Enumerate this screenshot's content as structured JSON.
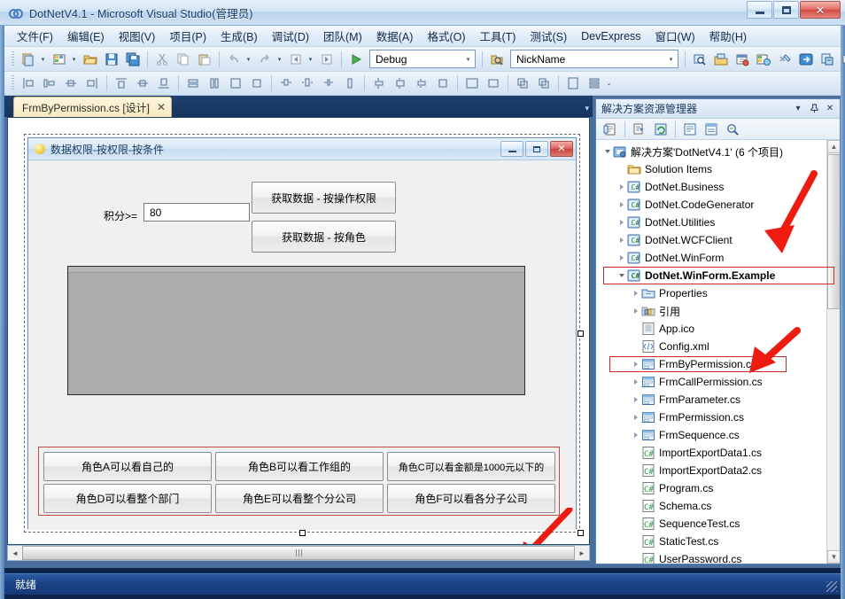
{
  "window": {
    "title": "DotNetV4.1 - Microsoft Visual Studio(管理员)",
    "app_icon": "visual-studio-icon",
    "minimize_label": "–",
    "maximize_label": "□",
    "close_label": "✕"
  },
  "menubar": {
    "items": [
      {
        "label": "文件(F)"
      },
      {
        "label": "编辑(E)"
      },
      {
        "label": "视图(V)"
      },
      {
        "label": "项目(P)"
      },
      {
        "label": "生成(B)"
      },
      {
        "label": "调试(D)"
      },
      {
        "label": "团队(M)"
      },
      {
        "label": "数据(A)"
      },
      {
        "label": "格式(O)"
      },
      {
        "label": "工具(T)"
      },
      {
        "label": "测试(S)"
      },
      {
        "label": "DevExpress"
      },
      {
        "label": "窗口(W)"
      },
      {
        "label": "帮助(H)"
      }
    ]
  },
  "toolbar": {
    "config_combo": {
      "value": "Debug",
      "caret": "▾"
    },
    "nickname_combo": {
      "value": "NickName",
      "caret": "▾"
    },
    "start_button_label": "▶",
    "icons": [
      "new-project-icon",
      "new-item-icon",
      "open-file-icon",
      "save-icon",
      "save-all-icon",
      "cut-icon",
      "copy-icon",
      "paste-icon",
      "undo-icon",
      "redo-icon",
      "navigate-backward-icon",
      "navigate-forward-icon"
    ],
    "right_icons": [
      "find-icon",
      "solution-explorer-icon",
      "properties-window-icon",
      "object-browser-icon",
      "toolbox-icon",
      "go-icon",
      "class-view-icon",
      "other-windows-icon"
    ],
    "layout_icons": [
      "align-lefts-icon",
      "align-centers-icon",
      "align-middles-icon",
      "align-rights-icon",
      "align-tops-icon",
      "align-middles2-icon",
      "align-bottoms-icon",
      "make-same-width-icon",
      "make-same-height-icon",
      "make-same-size-icon",
      "size-to-grid-icon",
      "horiz-spacing-equal-icon",
      "horiz-spacing-increase-icon",
      "horiz-spacing-decrease-icon",
      "horiz-spacing-remove-icon",
      "vert-spacing-equal-icon",
      "vert-spacing-increase-icon",
      "vert-spacing-decrease-icon",
      "vert-spacing-remove-icon",
      "center-horizontally-icon",
      "center-vertically-icon",
      "bring-to-front-icon",
      "send-to-back-icon",
      "tab-order-icon",
      "table-layout-icon"
    ]
  },
  "document_tabs": {
    "tabs": [
      {
        "label": "FrmByPermission.cs [设计]",
        "close_label": "✕",
        "active": true
      }
    ],
    "nav_label": "▾"
  },
  "designer": {
    "form": {
      "title": "数据权限-按权限-按条件",
      "icon": "form-icon",
      "minimize_label": "–",
      "maximize_label": "□",
      "close_label": "✕",
      "score_label": "积分>=",
      "score_value": "80",
      "buttons_top": [
        {
          "label": "获取数据 - 按操作权限"
        },
        {
          "label": "获取数据 - 按角色"
        }
      ],
      "grid_name": "data-grid-placeholder",
      "role_buttons": [
        {
          "label": "角色A可以看自己的"
        },
        {
          "label": "角色B可以看工作组的"
        },
        {
          "label": "角色C可以看金额是1000元以下的"
        },
        {
          "label": "角色D可以看整个部门"
        },
        {
          "label": "角色E可以看整个分公司"
        },
        {
          "label": "角色F可以看各分子公司"
        }
      ]
    },
    "hscroll": {
      "left_arrow": "◄",
      "right_arrow": "►",
      "grip": "⦙⦙⦙"
    }
  },
  "solution_explorer": {
    "title": "解决方案资源管理器",
    "header_buttons": [
      {
        "name": "dropdown",
        "label": "▾"
      },
      {
        "name": "auto-hide",
        "label": "⚲"
      },
      {
        "name": "close",
        "label": "✕"
      }
    ],
    "toolbar_icons": [
      "properties-icon",
      "show-all-files-icon",
      "refresh-icon",
      "view-code-icon",
      "view-designer-icon",
      "preview-selected-items-icon"
    ],
    "scroll": {
      "up": "▲",
      "down": "▼"
    },
    "tree": [
      {
        "label": "解决方案'DotNetV4.1' (6 个项目)",
        "indent": 0,
        "icon": "solution-icon",
        "expander": "open",
        "bold": false,
        "boxed": false
      },
      {
        "label": "Solution Items",
        "indent": 1,
        "icon": "folder-icon",
        "expander": "none",
        "bold": false,
        "boxed": false
      },
      {
        "label": "DotNet.Business",
        "indent": 1,
        "icon": "csharp-project-icon",
        "expander": "closed",
        "bold": false,
        "boxed": false
      },
      {
        "label": "DotNet.CodeGenerator",
        "indent": 1,
        "icon": "csharp-project-icon",
        "expander": "closed",
        "bold": false,
        "boxed": false
      },
      {
        "label": "DotNet.Utilities",
        "indent": 1,
        "icon": "csharp-project-icon",
        "expander": "closed",
        "bold": false,
        "boxed": false
      },
      {
        "label": "DotNet.WCFClient",
        "indent": 1,
        "icon": "csharp-project-icon",
        "expander": "closed",
        "bold": false,
        "boxed": false
      },
      {
        "label": "DotNet.WinForm",
        "indent": 1,
        "icon": "csharp-project-icon",
        "expander": "closed",
        "bold": false,
        "boxed": false
      },
      {
        "label": "DotNet.WinForm.Example",
        "indent": 1,
        "icon": "csharp-project-icon",
        "expander": "open",
        "bold": true,
        "boxed": true
      },
      {
        "label": "Properties",
        "indent": 2,
        "icon": "properties-folder-icon",
        "expander": "closed",
        "bold": false,
        "boxed": false
      },
      {
        "label": "引用",
        "indent": 2,
        "icon": "references-icon",
        "expander": "closed",
        "bold": false,
        "boxed": false
      },
      {
        "label": "App.ico",
        "indent": 2,
        "icon": "ico-file-icon",
        "expander": "none",
        "bold": false,
        "boxed": false
      },
      {
        "label": "Config.xml",
        "indent": 2,
        "icon": "xml-file-icon",
        "expander": "none",
        "bold": false,
        "boxed": false
      },
      {
        "label": "FrmByPermission.cs",
        "indent": 2,
        "icon": "form-file-icon",
        "expander": "closed",
        "bold": false,
        "boxed": true
      },
      {
        "label": "FrmCallPermission.cs",
        "indent": 2,
        "icon": "form-file-icon",
        "expander": "closed",
        "bold": false,
        "boxed": false
      },
      {
        "label": "FrmParameter.cs",
        "indent": 2,
        "icon": "form-file-icon",
        "expander": "closed",
        "bold": false,
        "boxed": false
      },
      {
        "label": "FrmPermission.cs",
        "indent": 2,
        "icon": "form-file-icon",
        "expander": "closed",
        "bold": false,
        "boxed": false
      },
      {
        "label": "FrmSequence.cs",
        "indent": 2,
        "icon": "form-file-icon",
        "expander": "closed",
        "bold": false,
        "boxed": false
      },
      {
        "label": "ImportExportData1.cs",
        "indent": 2,
        "icon": "csharp-file-icon",
        "expander": "none",
        "bold": false,
        "boxed": false
      },
      {
        "label": "ImportExportData2.cs",
        "indent": 2,
        "icon": "csharp-file-icon",
        "expander": "none",
        "bold": false,
        "boxed": false
      },
      {
        "label": "Program.cs",
        "indent": 2,
        "icon": "csharp-file-icon",
        "expander": "none",
        "bold": false,
        "boxed": false
      },
      {
        "label": "Schema.cs",
        "indent": 2,
        "icon": "csharp-file-icon",
        "expander": "none",
        "bold": false,
        "boxed": false
      },
      {
        "label": "SequenceTest.cs",
        "indent": 2,
        "icon": "csharp-file-icon",
        "expander": "none",
        "bold": false,
        "boxed": false
      },
      {
        "label": "StaticTest.cs",
        "indent": 2,
        "icon": "csharp-file-icon",
        "expander": "none",
        "bold": false,
        "boxed": false
      },
      {
        "label": "UserPassword.cs",
        "indent": 2,
        "icon": "csharp-file-icon",
        "expander": "none",
        "bold": false,
        "boxed": false
      }
    ]
  },
  "statusbar": {
    "text": "就绪"
  },
  "annotations": {
    "color": "#ee1c10",
    "arrows": [
      {
        "name": "arrow-to-project"
      },
      {
        "name": "arrow-to-file"
      },
      {
        "name": "arrow-to-role-buttons"
      }
    ],
    "highlight_boxes": [
      {
        "name": "box-project"
      },
      {
        "name": "box-file"
      },
      {
        "name": "box-role-buttons-panel"
      }
    ]
  }
}
